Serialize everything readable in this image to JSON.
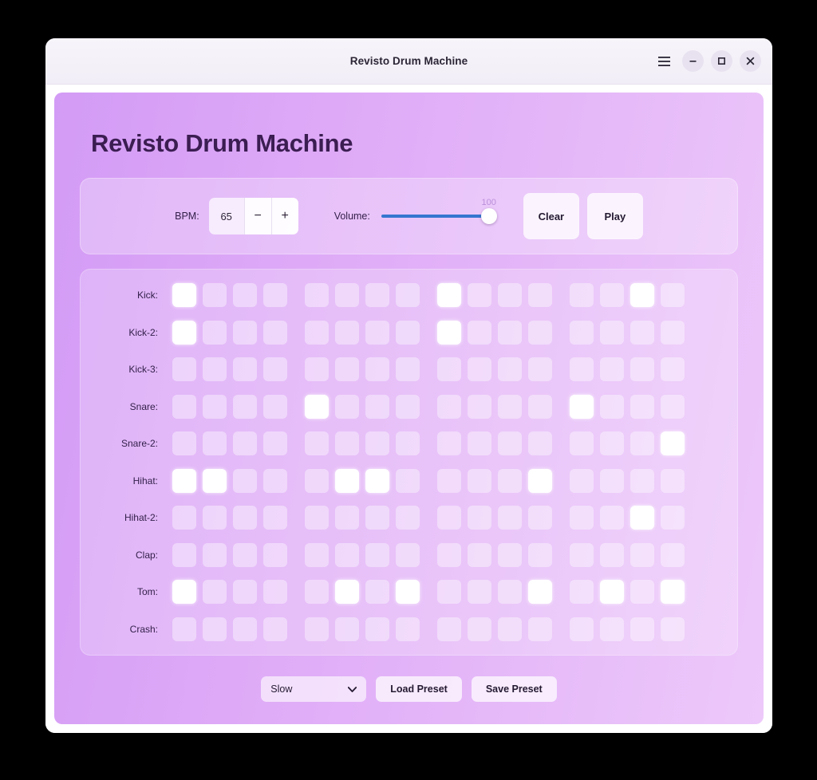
{
  "window": {
    "title": "Revisto Drum Machine",
    "controls": [
      {
        "name": "menu-button",
        "icon": "hamburger-menu-icon",
        "label": "☰"
      },
      {
        "name": "minimize-button",
        "icon": "minimize-icon",
        "label": "–"
      },
      {
        "name": "maximize-button",
        "icon": "maximize-icon",
        "label": "□"
      },
      {
        "name": "close-button",
        "icon": "close-icon",
        "label": "×"
      }
    ]
  },
  "app": {
    "heading": "Revisto Drum Machine",
    "background_gradient_from": "#d39bf5",
    "background_gradient_to": "#edc9fa",
    "heading_color": "#3b1d52"
  },
  "transport": {
    "bpm_label": "BPM:",
    "bpm_value": "65",
    "bpm_decrement_label": "−",
    "bpm_increment_label": "+",
    "volume_label": "Volume:",
    "volume_value": "100",
    "volume_track_color": "#3576d0",
    "clear_label": "Clear",
    "play_label": "Play"
  },
  "sequencer": {
    "steps_per_group": 4,
    "groups": 4,
    "tracks": [
      {
        "label": "Kick:",
        "steps": [
          1,
          0,
          0,
          0,
          0,
          0,
          0,
          0,
          1,
          0,
          0,
          0,
          0,
          0,
          1,
          0
        ]
      },
      {
        "label": "Kick-2:",
        "steps": [
          1,
          0,
          0,
          0,
          0,
          0,
          0,
          0,
          1,
          0,
          0,
          0,
          0,
          0,
          0,
          0
        ]
      },
      {
        "label": "Kick-3:",
        "steps": [
          0,
          0,
          0,
          0,
          0,
          0,
          0,
          0,
          0,
          0,
          0,
          0,
          0,
          0,
          0,
          0
        ]
      },
      {
        "label": "Snare:",
        "steps": [
          0,
          0,
          0,
          0,
          1,
          0,
          0,
          0,
          0,
          0,
          0,
          0,
          1,
          0,
          0,
          0
        ]
      },
      {
        "label": "Snare-2:",
        "steps": [
          0,
          0,
          0,
          0,
          0,
          0,
          0,
          0,
          0,
          0,
          0,
          0,
          0,
          0,
          0,
          1
        ]
      },
      {
        "label": "Hihat:",
        "steps": [
          1,
          1,
          0,
          0,
          0,
          1,
          1,
          0,
          0,
          0,
          0,
          1,
          0,
          0,
          0,
          0
        ]
      },
      {
        "label": "Hihat-2:",
        "steps": [
          0,
          0,
          0,
          0,
          0,
          0,
          0,
          0,
          0,
          0,
          0,
          0,
          0,
          0,
          1,
          0
        ]
      },
      {
        "label": "Clap:",
        "steps": [
          0,
          0,
          0,
          0,
          0,
          0,
          0,
          0,
          0,
          0,
          0,
          0,
          0,
          0,
          0,
          0
        ]
      },
      {
        "label": "Tom:",
        "steps": [
          1,
          0,
          0,
          0,
          0,
          1,
          0,
          1,
          0,
          0,
          0,
          1,
          0,
          1,
          0,
          1
        ]
      },
      {
        "label": "Crash:",
        "steps": [
          0,
          0,
          0,
          0,
          0,
          0,
          0,
          0,
          0,
          0,
          0,
          0,
          0,
          0,
          0,
          0
        ]
      }
    ]
  },
  "bottom": {
    "preset_selected": "Slow",
    "preset_caret": "▼",
    "load_preset_label": "Load Preset",
    "save_preset_label": "Save Preset"
  }
}
